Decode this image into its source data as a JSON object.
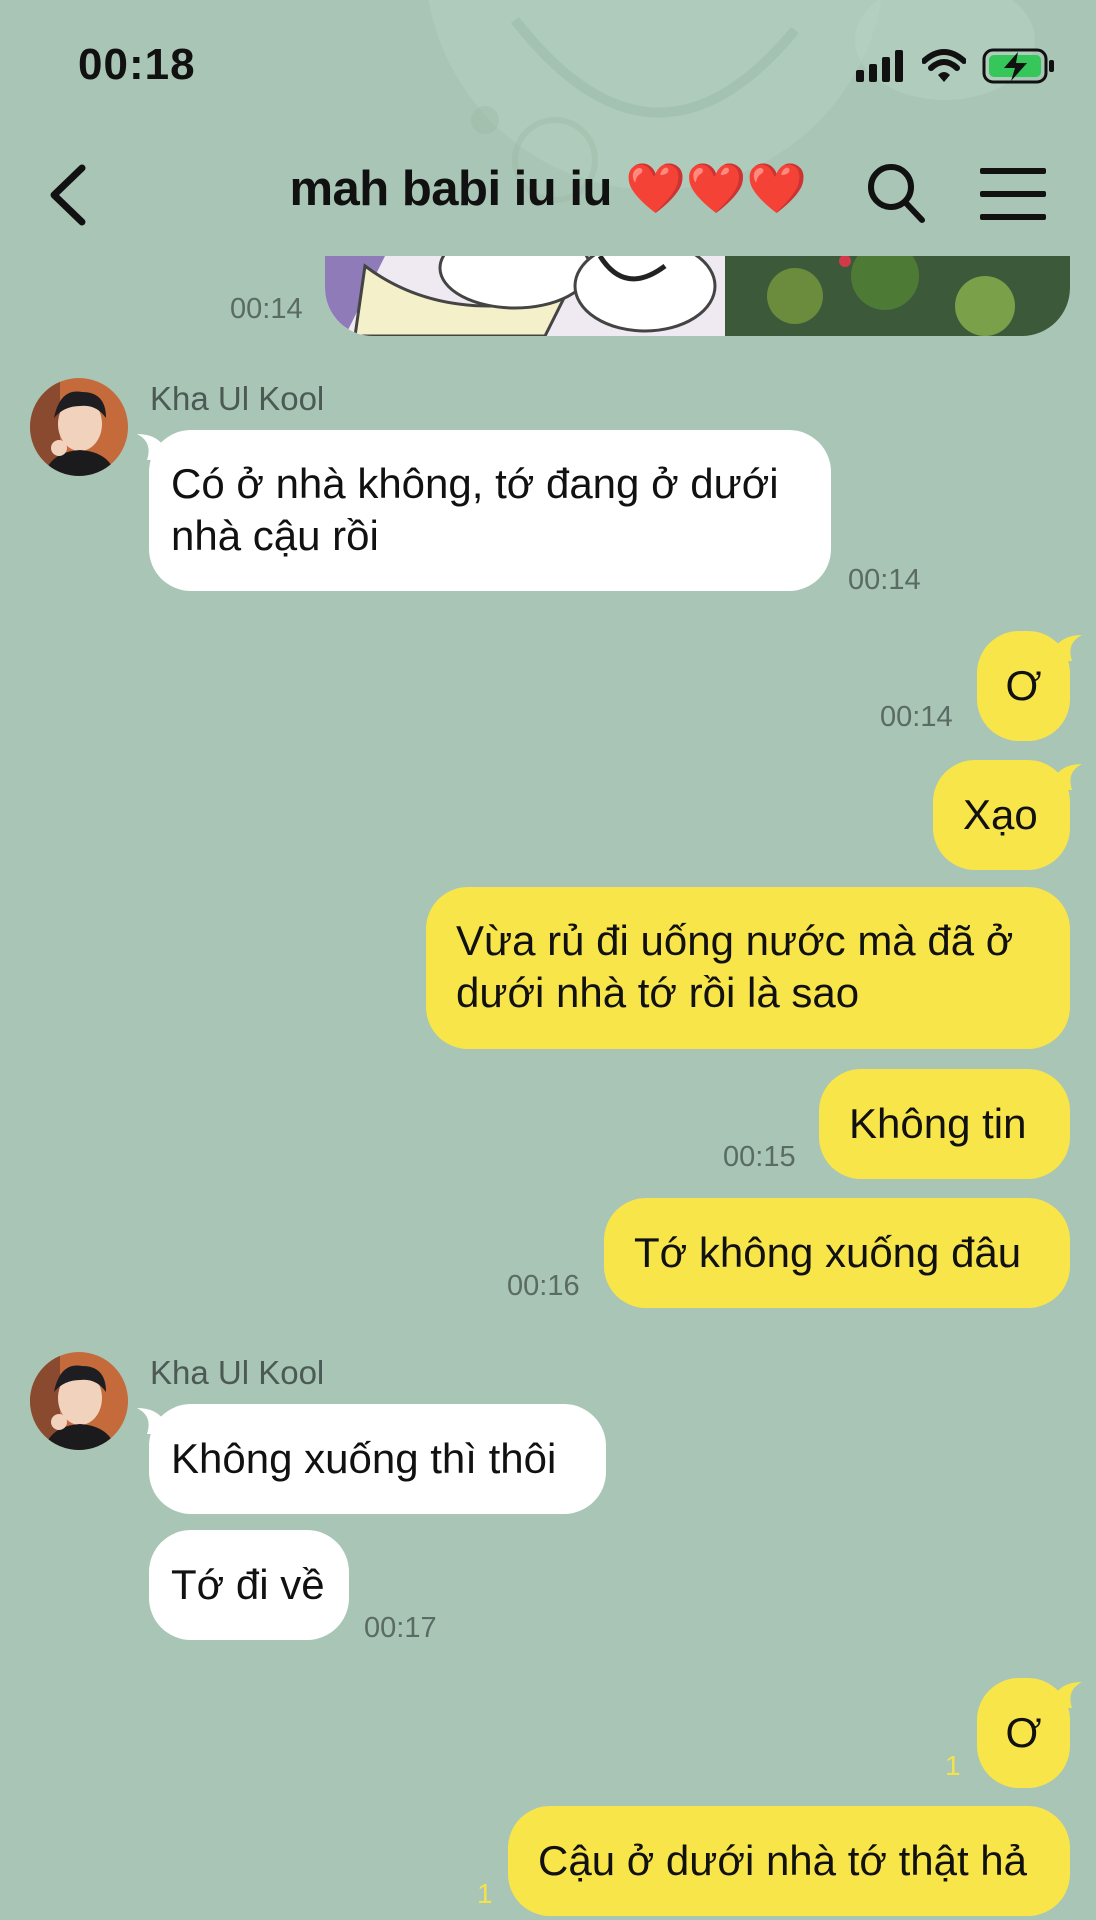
{
  "status_bar": {
    "time": "00:18"
  },
  "header": {
    "title": "mah babi iu iu ❤️❤️❤️"
  },
  "messages": {
    "m0": {
      "time": "00:14"
    },
    "m1": {
      "sender": "Kha Ul Kool",
      "line1": "Có ở nhà không, tớ đang ở dưới",
      "line2": "nhà cậu rồi",
      "time": "00:14"
    },
    "m2": {
      "text": "Ơ",
      "time": "00:14"
    },
    "m3": {
      "text": "Xạo"
    },
    "m4": {
      "line1": "Vừa rủ đi uống nước mà đã ở",
      "line2": "dưới nhà tớ rồi là sao"
    },
    "m5": {
      "text": "Không tin",
      "time": "00:15"
    },
    "m6": {
      "text": "Tớ không xuống đâu",
      "time": "00:16"
    },
    "m7": {
      "sender": "Kha Ul Kool",
      "text": "Không xuống thì thôi"
    },
    "m8": {
      "text": "Tớ đi về",
      "time": "00:17"
    },
    "m9": {
      "text": "Ơ",
      "read": "1"
    },
    "m10": {
      "text": "Cậu ở dưới nhà tớ thật hả",
      "read": "1"
    }
  },
  "icons": {
    "back": "chevron-left-icon",
    "search": "search-icon",
    "menu": "hamburger-menu-icon",
    "signal": "signal-icon",
    "wifi": "wifi-icon",
    "battery": "battery-charging-icon"
  },
  "colors": {
    "background": "#a8c5b5",
    "outgoing_bubble": "#f8e54a",
    "incoming_bubble": "#ffffff",
    "timestamp": "#5a6b63",
    "read_count": "#f5e24a"
  }
}
